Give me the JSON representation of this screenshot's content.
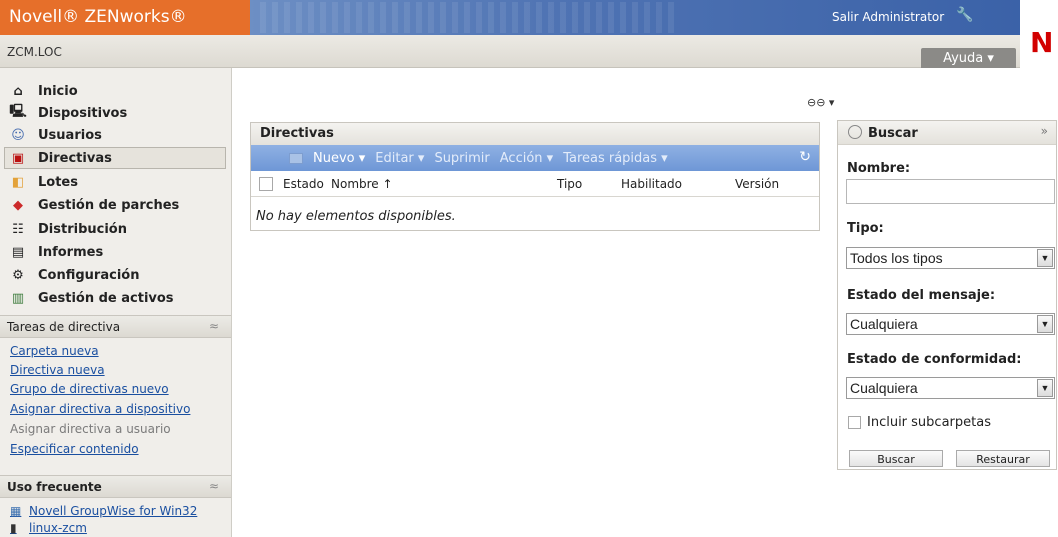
{
  "header": {
    "brand": "Novell® ZENworks®",
    "logout": "Salir Administrator",
    "logo": "N",
    "zone": "ZCM.LOC",
    "help": "Ayuda ▾"
  },
  "nav": {
    "items": [
      {
        "label": "Inicio",
        "icon": "home-icon"
      },
      {
        "label": "Dispositivos",
        "icon": "computer-icon"
      },
      {
        "label": "Usuarios",
        "icon": "user-icon"
      },
      {
        "label": "Directivas",
        "icon": "policy-icon"
      },
      {
        "label": "Lotes",
        "icon": "bundle-icon"
      },
      {
        "label": "Gestión de parches",
        "icon": "patch-icon"
      },
      {
        "label": "Distribución",
        "icon": "distribution-icon"
      },
      {
        "label": "Informes",
        "icon": "report-icon"
      },
      {
        "label": "Configuración",
        "icon": "config-icon"
      },
      {
        "label": "Gestión de activos",
        "icon": "asset-icon"
      }
    ]
  },
  "tasks": {
    "title": "Tareas de directiva",
    "links": [
      "Carpeta nueva",
      "Directiva nueva",
      "Grupo de directivas nuevo",
      "Asignar directiva a dispositivo",
      "Asignar directiva a usuario",
      "Especificar contenido"
    ]
  },
  "frequent": {
    "title": "Uso frecuente",
    "items": [
      "Novell GroupWise for Win32",
      "linux-zcm"
    ]
  },
  "list": {
    "title": "Directivas",
    "toolbar": {
      "new": "Nuevo ▾",
      "edit": "Editar ▾",
      "delete": "Suprimir",
      "action": "Acción ▾",
      "quick": "Tareas rápidas ▾"
    },
    "columns": {
      "status": "Estado",
      "name": "Nombre ↑",
      "type": "Tipo",
      "enabled": "Habilitado",
      "version": "Versión"
    },
    "empty": "No hay elementos disponibles."
  },
  "search": {
    "title": "Buscar",
    "name_label": "Nombre:",
    "name_value": "",
    "type_label": "Tipo:",
    "type_value": "Todos los tipos",
    "msg_label": "Estado del mensaje:",
    "msg_value": "Cualquiera",
    "conf_label": "Estado de conformidad:",
    "conf_value": "Cualquiera",
    "subfolders": "Incluir subcarpetas",
    "search_btn": "Buscar",
    "reset_btn": "Restaurar"
  },
  "colors": {
    "brand_orange": "#e66f2a",
    "banner_blue": "#3b62a8",
    "toolbar_blue": "#7ea3dc",
    "link_blue": "#1a4fa0",
    "logo_red": "#d20000"
  }
}
